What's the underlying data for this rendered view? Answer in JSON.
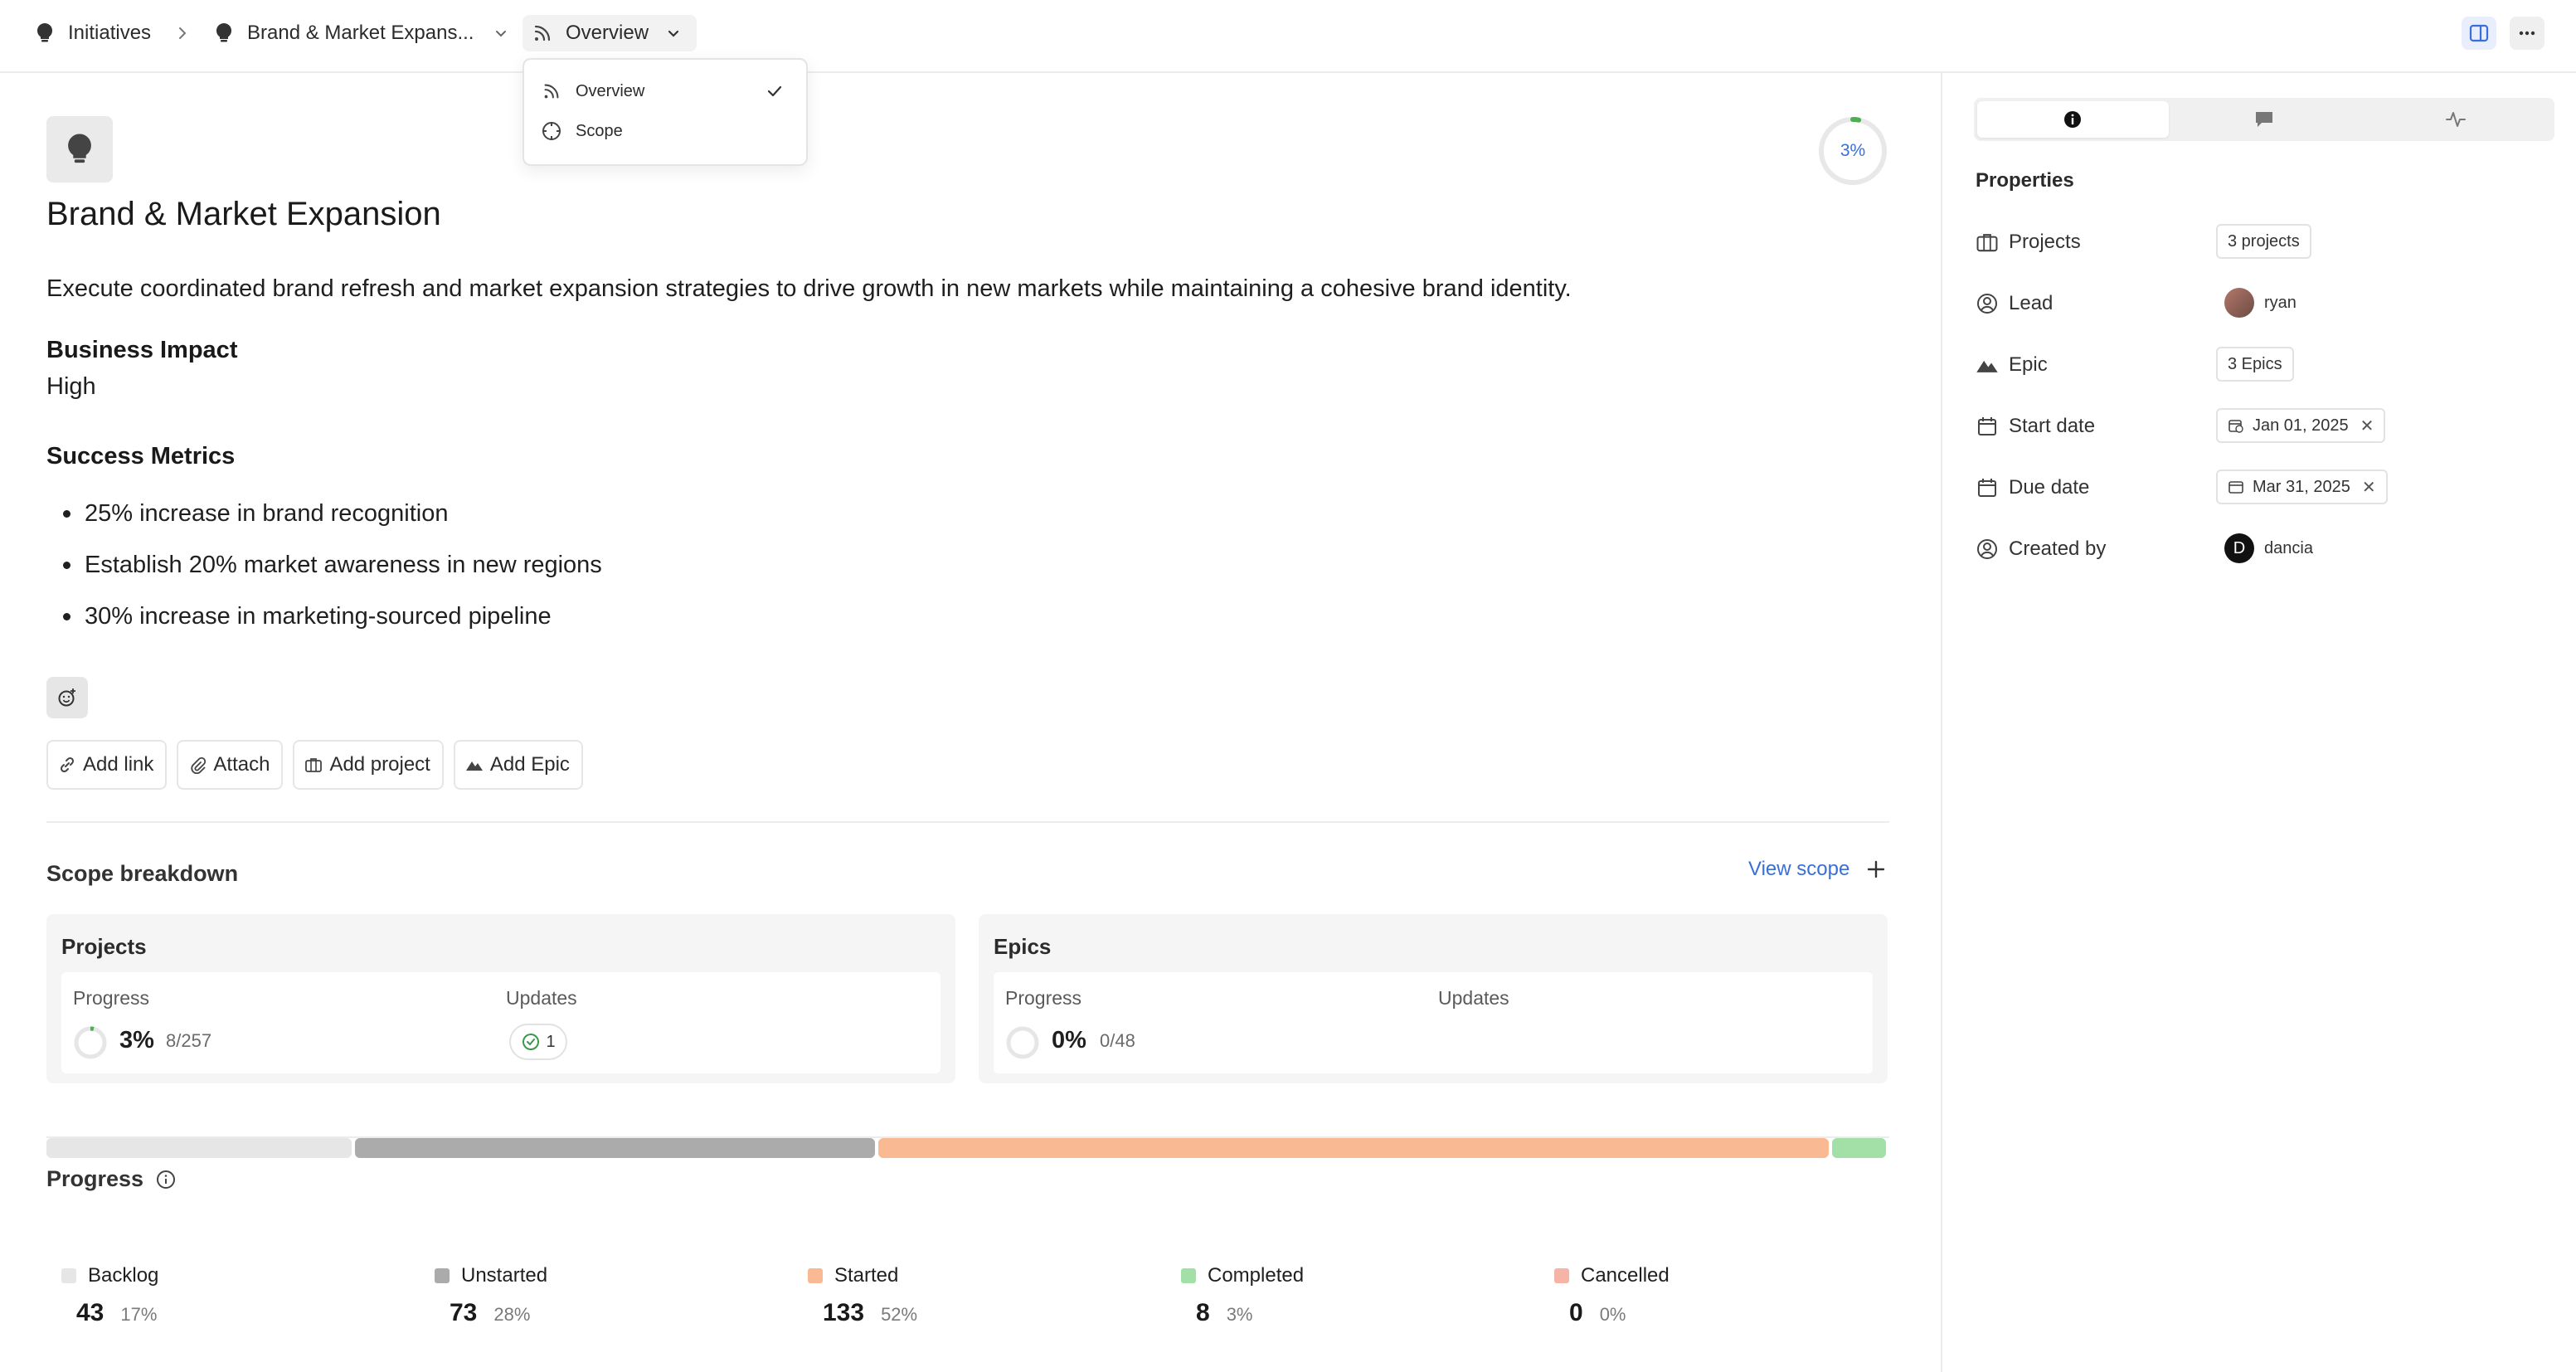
{
  "breadcrumb": {
    "root_label": "Initiatives",
    "initiative_label": "Brand & Market Expans...",
    "view_label": "Overview"
  },
  "view_menu": {
    "items": [
      {
        "label": "Overview",
        "icon": "rss-icon",
        "selected": true
      },
      {
        "label": "Scope",
        "icon": "crosshair-icon",
        "selected": false
      }
    ]
  },
  "initiative": {
    "icon": "lightbulb-icon",
    "progress_label": "3%",
    "progress_value": 0.03,
    "title": "Brand & Market Expansion",
    "description": "Execute coordinated brand refresh and market expansion strategies to drive growth in new markets while maintaining a cohesive brand identity.",
    "business_impact_heading": "Business Impact",
    "business_impact_value": "High",
    "success_metrics_heading": "Success Metrics",
    "success_metrics": [
      "25% increase in brand recognition",
      "Establish 20% market awareness in new regions",
      "30% increase in marketing-sourced pipeline"
    ]
  },
  "actions": {
    "add_link": "Add link",
    "attach": "Attach",
    "add_project": "Add project",
    "add_epic": "Add Epic"
  },
  "scope": {
    "title": "Scope breakdown",
    "view_scope_label": "View scope",
    "projects": {
      "title": "Projects",
      "progress_label": "Progress",
      "updates_label": "Updates",
      "percent": "3%",
      "percent_value": 0.03,
      "fraction": "8/257",
      "updates_count": "1"
    },
    "epics": {
      "title": "Epics",
      "progress_label": "Progress",
      "updates_label": "Updates",
      "percent": "0%",
      "percent_value": 0,
      "fraction": "0/48"
    }
  },
  "progress": {
    "title": "Progress",
    "states": [
      {
        "name": "Backlog",
        "count": "43",
        "percent": "17%",
        "value": 43,
        "color": "#e6e6e6"
      },
      {
        "name": "Unstarted",
        "count": "73",
        "percent": "28%",
        "value": 73,
        "color": "#ababab"
      },
      {
        "name": "Started",
        "count": "133",
        "percent": "52%",
        "value": 133,
        "color": "#f8b993"
      },
      {
        "name": "Completed",
        "count": "8",
        "percent": "3%",
        "value": 8,
        "color": "#a3e0a8"
      },
      {
        "name": "Cancelled",
        "count": "0",
        "percent": "0%",
        "value": 0,
        "color": "#f5b4a6"
      }
    ]
  },
  "properties": {
    "title": "Properties",
    "projects": {
      "label": "Projects",
      "value": "3 projects"
    },
    "lead": {
      "label": "Lead",
      "value": "ryan"
    },
    "epic": {
      "label": "Epic",
      "value": "3 Epics"
    },
    "start_date": {
      "label": "Start date",
      "value": "Jan 01, 2025"
    },
    "due_date": {
      "label": "Due date",
      "value": "Mar 31, 2025"
    },
    "created_by": {
      "label": "Created by",
      "value": "dancia",
      "initial": "D"
    }
  },
  "colors": {
    "accent": "#3a6fd8",
    "progress_green": "#4caf50"
  }
}
